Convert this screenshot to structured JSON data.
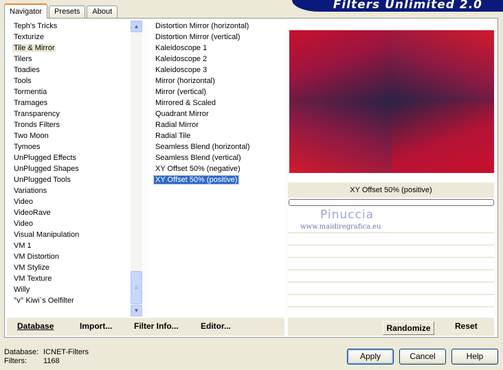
{
  "banner": {
    "title": "Filters Unlimited 2.0"
  },
  "tabs": [
    {
      "label": "Navigator",
      "active": true
    },
    {
      "label": "Presets",
      "active": false
    },
    {
      "label": "About",
      "active": false
    }
  ],
  "categories": {
    "selected": "Tile & Mirror",
    "items": [
      "Teph's Tricks",
      "Texturize",
      "Tile & Mirror",
      "Tilers",
      "Toadies",
      "Tools",
      "Tormentia",
      "Tramages",
      "Transparency",
      "Tronds Filters",
      "Two Moon",
      "Tymoes",
      "UnPlugged Effects",
      "UnPlugged Shapes",
      "UnPlugged Tools",
      "Variations",
      "Video",
      "VideoRave",
      "Video",
      "Visual Manipulation",
      "VM 1",
      "VM Distortion",
      "VM Stylize",
      "VM Texture",
      "Willy",
      "°v° Kiwi`s Oelfilter"
    ]
  },
  "filters": {
    "selected": "XY Offset 50% (positive)",
    "items": [
      "Distortion Mirror (horizontal)",
      "Distortion Mirror (vertical)",
      "Kaleidoscope 1",
      "Kaleidoscope 2",
      "Kaleidoscope 3",
      "Mirror (horizontal)",
      "Mirror (vertical)",
      "Mirrored & Scaled",
      "Quadrant Mirror",
      "Radial Mirror",
      "Radial Tile",
      "Seamless Blend (horizontal)",
      "Seamless Blend (vertical)",
      "XY Offset 50% (negative)",
      "XY Offset 50% (positive)"
    ]
  },
  "preview": {
    "filter_name": "XY Offset 50% (positive)",
    "progress": 0,
    "colors": {
      "red": "#c8102e",
      "navy": "#2c2246"
    }
  },
  "watermark": {
    "name": "Pinuccia",
    "url": "www.maidiregrafica.eu"
  },
  "bottom_buttons": {
    "database": "Database",
    "import": "Import...",
    "filter_info": "Filter Info...",
    "editor": "Editor...",
    "randomize": "Randomize",
    "reset": "Reset"
  },
  "status": {
    "database_label": "Database:",
    "database_value": "ICNET-Filters",
    "filters_label": "Filters:",
    "filters_value": "1168"
  },
  "dialog_buttons": {
    "apply": "Apply",
    "cancel": "Cancel",
    "help": "Help"
  },
  "icons": {
    "scroll_up": "chevron-up-icon",
    "scroll_down": "chevron-down-icon"
  }
}
